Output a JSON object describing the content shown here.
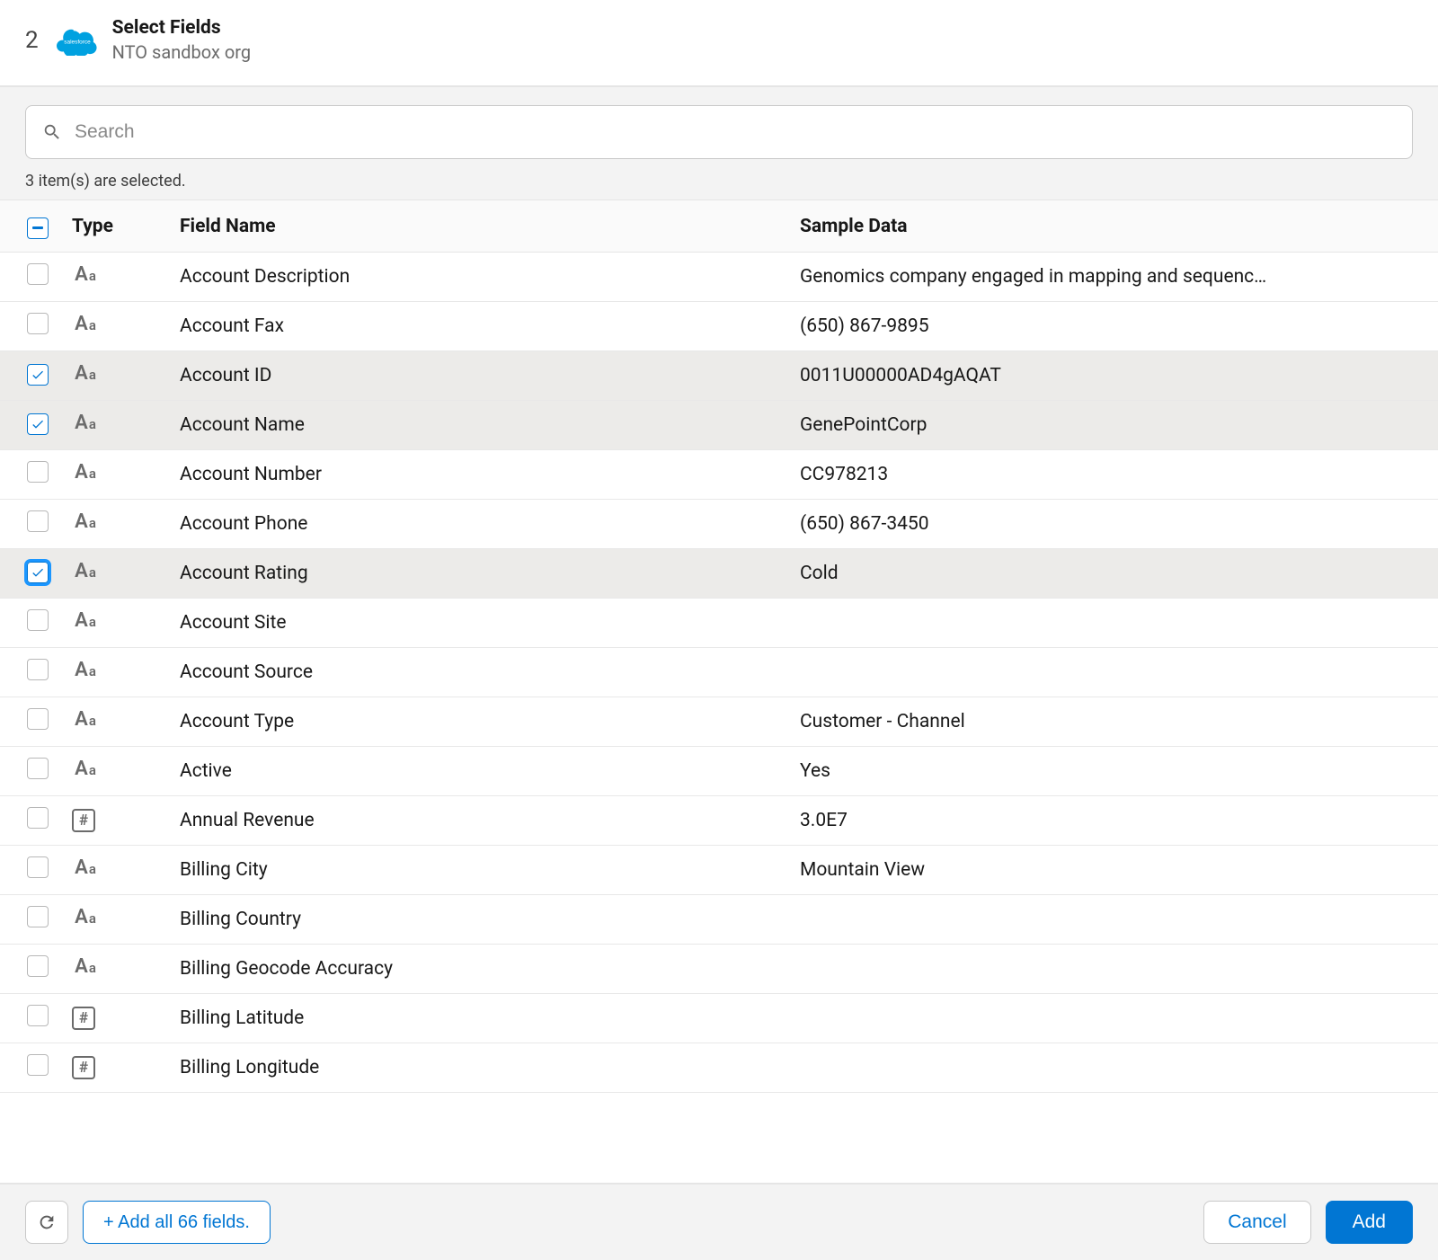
{
  "header": {
    "step_number": "2",
    "title": "Select Fields",
    "subtitle": "NTO sandbox org",
    "logo_name": "salesforce-cloud-icon",
    "logo_text": "salesforce"
  },
  "search": {
    "placeholder": "Search",
    "value": ""
  },
  "selection_status": "3 item(s) are selected.",
  "table": {
    "columns": {
      "type": "Type",
      "field_name": "Field Name",
      "sample_data": "Sample Data"
    },
    "rows": [
      {
        "selected": false,
        "focused": false,
        "type": "text",
        "field_name": "Account Description",
        "sample_data": "Genomics company engaged in mapping and sequenc…"
      },
      {
        "selected": false,
        "focused": false,
        "type": "text",
        "field_name": "Account Fax",
        "sample_data": "(650) 867-9895"
      },
      {
        "selected": true,
        "focused": false,
        "type": "text",
        "field_name": "Account ID",
        "sample_data": "0011U00000AD4gAQAT"
      },
      {
        "selected": true,
        "focused": false,
        "type": "text",
        "field_name": "Account Name",
        "sample_data": "GenePointCorp"
      },
      {
        "selected": false,
        "focused": false,
        "type": "text",
        "field_name": "Account Number",
        "sample_data": "CC978213"
      },
      {
        "selected": false,
        "focused": false,
        "type": "text",
        "field_name": "Account Phone",
        "sample_data": "(650) 867-3450"
      },
      {
        "selected": true,
        "focused": true,
        "type": "text",
        "field_name": "Account Rating",
        "sample_data": "Cold"
      },
      {
        "selected": false,
        "focused": false,
        "type": "text",
        "field_name": "Account Site",
        "sample_data": ""
      },
      {
        "selected": false,
        "focused": false,
        "type": "text",
        "field_name": "Account Source",
        "sample_data": ""
      },
      {
        "selected": false,
        "focused": false,
        "type": "text",
        "field_name": "Account Type",
        "sample_data": "Customer - Channel"
      },
      {
        "selected": false,
        "focused": false,
        "type": "text",
        "field_name": "Active",
        "sample_data": "Yes"
      },
      {
        "selected": false,
        "focused": false,
        "type": "number",
        "field_name": "Annual Revenue",
        "sample_data": "3.0E7"
      },
      {
        "selected": false,
        "focused": false,
        "type": "text",
        "field_name": "Billing City",
        "sample_data": "Mountain View"
      },
      {
        "selected": false,
        "focused": false,
        "type": "text",
        "field_name": "Billing Country",
        "sample_data": ""
      },
      {
        "selected": false,
        "focused": false,
        "type": "text",
        "field_name": "Billing Geocode Accuracy",
        "sample_data": ""
      },
      {
        "selected": false,
        "focused": false,
        "type": "number",
        "field_name": "Billing Latitude",
        "sample_data": ""
      },
      {
        "selected": false,
        "focused": false,
        "type": "number",
        "field_name": "Billing Longitude",
        "sample_data": ""
      }
    ]
  },
  "footer": {
    "add_all_label": "+ Add all 66 fields.",
    "cancel_label": "Cancel",
    "add_label": "Add"
  }
}
